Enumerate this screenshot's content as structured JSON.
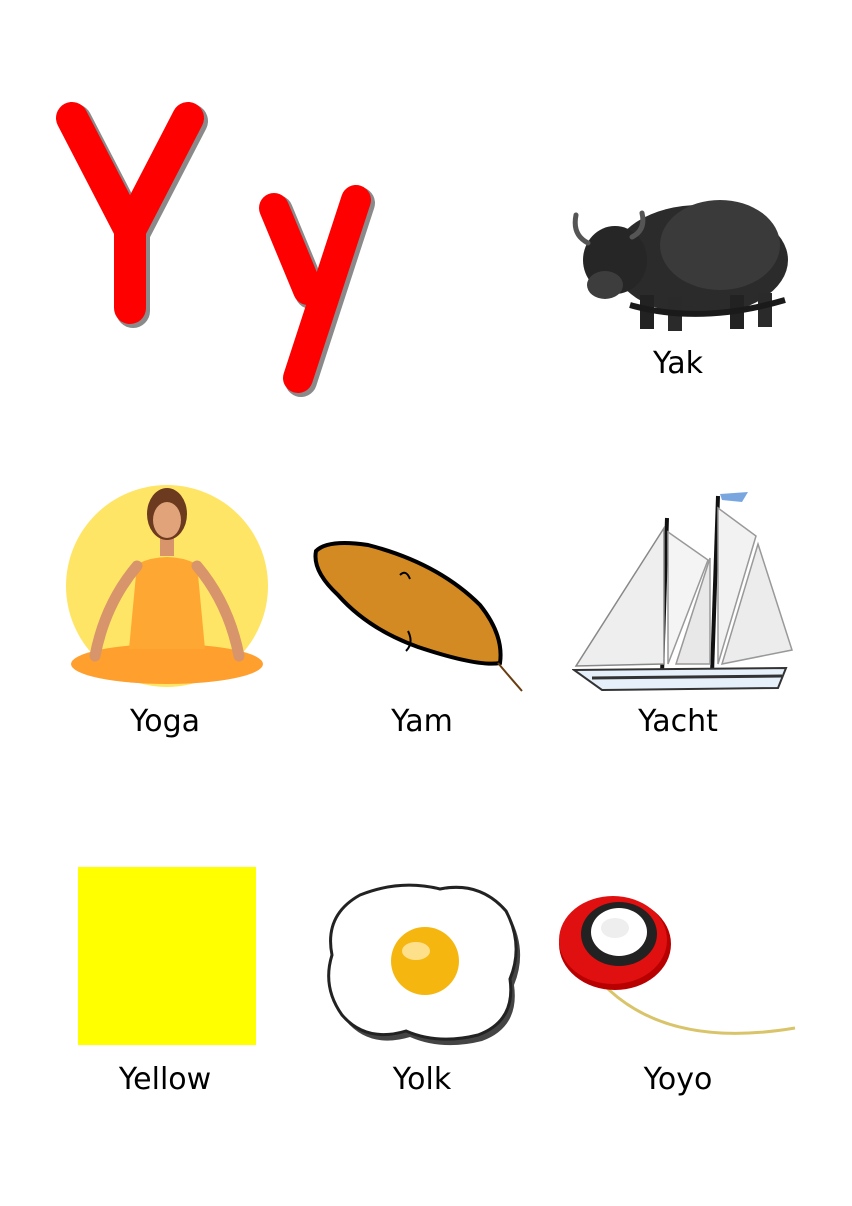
{
  "page": {
    "big_letters": {
      "upper": "Y",
      "lower": "y"
    }
  },
  "items": [
    {
      "id": "yak",
      "label": "Yak"
    },
    {
      "id": "yoga",
      "label": "Yoga"
    },
    {
      "id": "yam",
      "label": "Yam"
    },
    {
      "id": "yacht",
      "label": "Yacht"
    },
    {
      "id": "yellow",
      "label": "Yellow"
    },
    {
      "id": "yolk",
      "label": "Yolk"
    },
    {
      "id": "yoyo",
      "label": "Yoyo"
    }
  ],
  "colors": {
    "letter_red": "#ff0000",
    "yellow_swatch": "#ffff00",
    "yolk": "#f5b60f",
    "yam": "#d48a22",
    "yoga_sun": "#ffe566",
    "yoga_outfit": "#ffa733"
  }
}
